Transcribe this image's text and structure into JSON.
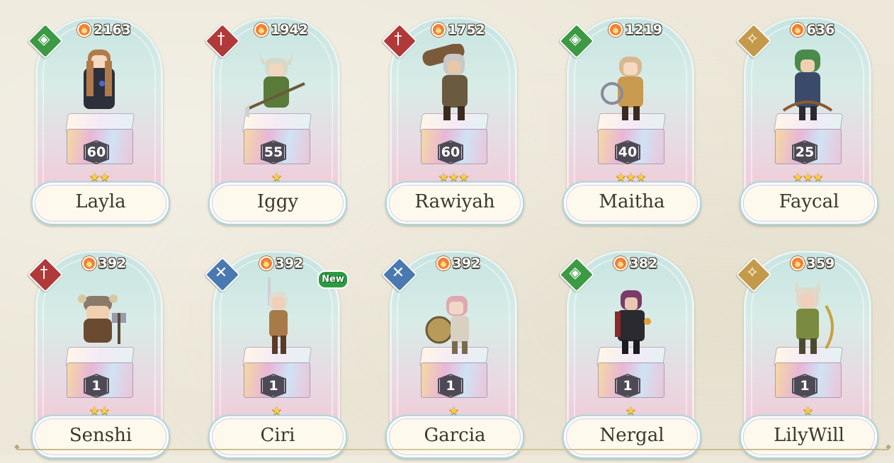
{
  "roster": [
    {
      "name": "Layla",
      "power": "2163",
      "level": "60",
      "stars": "★★",
      "role": "green",
      "role_icon": "shield-icon",
      "role_glyph": "◈",
      "new": "",
      "hair": "#b07a4a",
      "outfit": "#2d2f3a"
    },
    {
      "name": "Iggy",
      "power": "1942",
      "level": "55",
      "stars": "★",
      "role": "red",
      "role_icon": "sword-icon",
      "role_glyph": "†",
      "new": "",
      "hair": "#d8d8c8",
      "outfit": "#5a7a3a"
    },
    {
      "name": "Rawiyah",
      "power": "1752",
      "level": "60",
      "stars": "★★★",
      "role": "red",
      "role_icon": "sword-icon",
      "role_glyph": "†",
      "new": "",
      "hair": "#c8c8c8",
      "outfit": "#6a5a40"
    },
    {
      "name": "Maitha",
      "power": "1219",
      "level": "40",
      "stars": "★★★",
      "role": "green",
      "role_icon": "shield-icon",
      "role_glyph": "◈",
      "new": "",
      "hair": "#d8b890",
      "outfit": "#c89a50"
    },
    {
      "name": "Faycal",
      "power": "636",
      "level": "25",
      "stars": "★★★",
      "role": "gold",
      "role_icon": "compass-star-icon",
      "role_glyph": "✧",
      "new": "",
      "hair": "#4a8a4a",
      "outfit": "#3a4a6a"
    },
    {
      "name": "Senshi",
      "power": "392",
      "level": "1",
      "stars": "★★",
      "role": "red",
      "role_icon": "sword-icon",
      "role_glyph": "†",
      "new": "",
      "hair": "#7a5a3a",
      "outfit": "#6a4a30"
    },
    {
      "name": "Ciri",
      "power": "392",
      "level": "1",
      "stars": "★",
      "role": "blue",
      "role_icon": "crossed-blades-icon",
      "role_glyph": "✕",
      "new": "New",
      "hair": "#e0dcd0",
      "outfit": "#a87a4a"
    },
    {
      "name": "Garcia",
      "power": "392",
      "level": "1",
      "stars": "★",
      "role": "blue",
      "role_icon": "crossed-blades-icon",
      "role_glyph": "✕",
      "new": "",
      "hair": "#e0a8b0",
      "outfit": "#b89a5a"
    },
    {
      "name": "Nergal",
      "power": "382",
      "level": "1",
      "stars": "★",
      "role": "green",
      "role_icon": "shield-icon",
      "role_glyph": "◈",
      "new": "",
      "hair": "#7a3a6a",
      "outfit": "#2a2a30"
    },
    {
      "name": "LilyWill",
      "power": "359",
      "level": "1",
      "stars": "★",
      "role": "gold",
      "role_icon": "compass-star-icon",
      "role_glyph": "✧",
      "new": "",
      "hair": "#e0d8c8",
      "outfit": "#7a8a40"
    }
  ]
}
